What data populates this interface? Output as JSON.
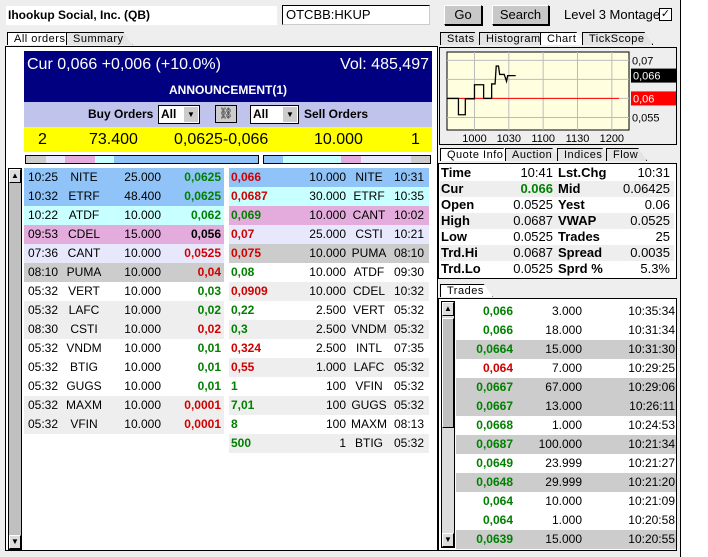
{
  "header": {
    "company": "Ihookup Social, Inc. (QB)",
    "symbol": "OTCBB:HKUP",
    "go": "Go",
    "search": "Search",
    "level3": "Level 3 Montage",
    "level3_checked": true
  },
  "left_tabs": [
    "All orders",
    "Summary"
  ],
  "summary": {
    "cur": "Cur 0,066 +0,006 (+10.0%)",
    "vol": "Vol: 485,497",
    "announcement": "ANNOUNCEMENT(1)",
    "buy_label": "Buy Orders",
    "sell_label": "Sell Orders",
    "buy_filter": "All",
    "sell_filter": "All",
    "bid_count": "2",
    "bid_size": "73.400",
    "spread": "0,0625-0,066",
    "ask_size": "10.000",
    "ask_count": "1"
  },
  "colors": {
    "blue": "#90c4f8",
    "cyan": "#c8ffff",
    "pink": "#e4acdc",
    "lavender": "#e8e8fc",
    "gray": "#cccccc",
    "header": "#000080",
    "toolbar": "#c0c4ec",
    "yellow": "#ffff00",
    "green": "#008000",
    "red": "#d00000"
  },
  "depth_bar_buy": [
    [
      "gray",
      1
    ],
    [
      "lavender",
      1
    ],
    [
      "pink",
      1.5
    ],
    [
      "cyan",
      1
    ],
    [
      "blue",
      7.3
    ]
  ],
  "depth_bar_sell": [
    [
      "blue",
      1
    ],
    [
      "cyan",
      3
    ],
    [
      "pink",
      1
    ],
    [
      "lavender",
      2.6
    ],
    [
      "gray",
      1
    ]
  ],
  "bids": [
    [
      "10:25",
      "NITE",
      "25.000",
      "0,0625",
      "g",
      "blue"
    ],
    [
      "10:32",
      "ETRF",
      "48.400",
      "0,0625",
      "g",
      "blue"
    ],
    [
      "10:22",
      "ATDF",
      "10.000",
      "0,062",
      "g",
      "cyan"
    ],
    [
      "09:53",
      "CDEL",
      "15.000",
      "0,056",
      "k",
      "pink"
    ],
    [
      "07:36",
      "CANT",
      "10.000",
      "0,0525",
      "r",
      "lavender"
    ],
    [
      "08:10",
      "PUMA",
      "10.000",
      "0,04",
      "r",
      "gray"
    ],
    [
      "05:32",
      "VERT",
      "10.000",
      "0,03",
      "g",
      "white"
    ],
    [
      "05:32",
      "LAFC",
      "10.000",
      "0,02",
      "g",
      "light"
    ],
    [
      "08:30",
      "CSTI",
      "10.000",
      "0,02",
      "r",
      "light"
    ],
    [
      "05:32",
      "VNDM",
      "10.000",
      "0,01",
      "g",
      "white"
    ],
    [
      "05:32",
      "BTIG",
      "10.000",
      "0,01",
      "g",
      "white"
    ],
    [
      "05:32",
      "GUGS",
      "10.000",
      "0,01",
      "g",
      "white"
    ],
    [
      "05:32",
      "MAXM",
      "10.000",
      "0,0001",
      "r",
      "light"
    ],
    [
      "05:32",
      "VFIN",
      "10.000",
      "0,0001",
      "r",
      "light"
    ]
  ],
  "asks": [
    [
      "0,066",
      "r",
      "10.000",
      "NITE",
      "10:31",
      "blue"
    ],
    [
      "0,0687",
      "r",
      "30.000",
      "ETRF",
      "10:35",
      "cyan"
    ],
    [
      "0,069",
      "g",
      "10.000",
      "CANT",
      "10:02",
      "pink"
    ],
    [
      "0,07",
      "r",
      "25.000",
      "CSTI",
      "10:21",
      "lavender"
    ],
    [
      "0,075",
      "r",
      "10.000",
      "PUMA",
      "08:10",
      "gray"
    ],
    [
      "0,08",
      "g",
      "10.000",
      "ATDF",
      "09:30",
      "white"
    ],
    [
      "0,0909",
      "r",
      "10.000",
      "CDEL",
      "10:32",
      "light"
    ],
    [
      "0,22",
      "g",
      "2.500",
      "VERT",
      "05:32",
      "white"
    ],
    [
      "0,3",
      "g",
      "2.500",
      "VNDM",
      "05:32",
      "light"
    ],
    [
      "0,324",
      "r",
      "2.500",
      "INTL",
      "07:35",
      "white"
    ],
    [
      "0,55",
      "r",
      "1.000",
      "LAFC",
      "05:32",
      "light"
    ],
    [
      "1",
      "g",
      "100",
      "VFIN",
      "05:32",
      "white"
    ],
    [
      "7,01",
      "g",
      "100",
      "GUGS",
      "05:32",
      "light"
    ],
    [
      "8",
      "g",
      "100",
      "MAXM",
      "08:13",
      "white"
    ],
    [
      "500",
      "g",
      "1",
      "BTIG",
      "05:32",
      "light"
    ]
  ],
  "right_tabs": [
    "Stats",
    "Histogram",
    "Chart",
    "TickScope"
  ],
  "chart_data": {
    "type": "line",
    "x_ticks": [
      "1000",
      "1030",
      "1100",
      "1130",
      "1200"
    ],
    "x_range": [
      "09:36",
      "12:15"
    ],
    "y_ticks": [
      "0,07",
      "0,055"
    ],
    "ylim": [
      0.0517,
      0.0722
    ],
    "current_label": "0,066",
    "current": 0.066,
    "reference_label": "0,06",
    "reference": 0.06,
    "grid": true,
    "series": [
      [
        "09:36",
        0.06
      ],
      [
        "09:46",
        0.06
      ],
      [
        "09:46",
        0.0557
      ],
      [
        "09:52",
        0.0557
      ],
      [
        "09:52",
        0.0599
      ],
      [
        "10:00",
        0.0599
      ],
      [
        "10:00",
        0.0636
      ],
      [
        "10:08",
        0.0636
      ],
      [
        "10:08",
        0.06
      ],
      [
        "10:15",
        0.06
      ],
      [
        "10:15",
        0.0638
      ],
      [
        "10:18",
        0.0638
      ],
      [
        "10:19",
        0.0685
      ],
      [
        "10:21",
        0.0685
      ],
      [
        "10:22",
        0.0663
      ],
      [
        "10:26",
        0.0663
      ],
      [
        "10:28",
        0.0645
      ],
      [
        "10:29",
        0.066
      ],
      [
        "10:36",
        0.066
      ]
    ]
  },
  "quote_tabs": [
    "Quote Info",
    "Auction",
    "Indices",
    "Flow"
  ],
  "quote": [
    [
      "Time",
      "10:41",
      "Lst.Chg",
      "10:31"
    ],
    [
      "Cur",
      "0.066",
      "Mid",
      "0.06425"
    ],
    [
      " Open",
      "0.0525",
      "Yest",
      "0.06"
    ],
    [
      "High",
      "0.0687",
      "VWAP",
      "0.0525"
    ],
    [
      "Low",
      "0.0525",
      "Trades",
      "25"
    ],
    [
      "Trd.Hi",
      "0.0687",
      "Spread",
      "0.0035"
    ],
    [
      "Trd.Lo",
      "0.0525",
      "Sprd %",
      "5.3%"
    ]
  ],
  "trades_tab": "Trades",
  "trades": [
    [
      "0,066",
      "g",
      "3.000",
      "10:35:34",
      "white"
    ],
    [
      "0,066",
      "g",
      "18.000",
      "10:31:34",
      "white"
    ],
    [
      "0,0664",
      "g",
      "15.000",
      "10:31:30",
      "gray"
    ],
    [
      "0,064",
      "r",
      "7.000",
      "10:29:25",
      "white"
    ],
    [
      "0,0667",
      "g",
      "67.000",
      "10:29:06",
      "gray"
    ],
    [
      "0,0667",
      "g",
      "13.000",
      "10:26:11",
      "gray"
    ],
    [
      "0,0668",
      "g",
      "1.000",
      "10:24:53",
      "white"
    ],
    [
      "0,0687",
      "g",
      "100.000",
      "10:21:34",
      "gray"
    ],
    [
      "0,0649",
      "g",
      "23.999",
      "10:21:27",
      "white"
    ],
    [
      "0,0648",
      "g",
      "29.999",
      "10:21:20",
      "gray"
    ],
    [
      "0,064",
      "g",
      "10.000",
      "10:21:09",
      "white"
    ],
    [
      "0,064",
      "g",
      "1.000",
      "10:20:58",
      "white"
    ],
    [
      "0,0639",
      "g",
      "15.000",
      "10:20:55",
      "gray"
    ]
  ]
}
